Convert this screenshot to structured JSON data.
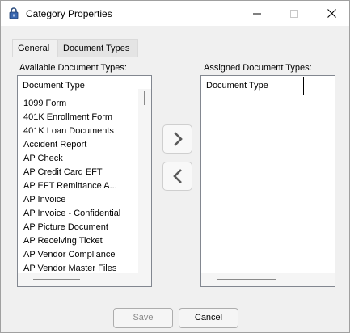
{
  "window": {
    "title": "Category Properties"
  },
  "tabs": [
    {
      "label": "General"
    },
    {
      "label": "Document Types"
    }
  ],
  "available": {
    "label": "Available Document Types:",
    "column_header": "Document Type",
    "items": [
      "1099 Form",
      "401K Enrollment Form",
      "401K Loan Documents",
      "Accident Report",
      "AP Check",
      "AP Credit Card EFT",
      "AP EFT Remittance A...",
      "AP Invoice",
      "AP Invoice - Confidential",
      "AP Picture Document",
      "AP Receiving Ticket",
      "AP Vendor Compliance",
      "AP Vendor Master Files"
    ]
  },
  "assigned": {
    "label": "Assigned Document Types:",
    "column_header": "Document Type",
    "items": []
  },
  "buttons": {
    "save": "Save",
    "cancel": "Cancel"
  },
  "icons": {
    "window_icon": "padlock-icon",
    "assign": "chevron-right-icon",
    "unassign": "chevron-left-icon"
  },
  "colors": {
    "window_bg": "#f0f0f0",
    "list_bg": "#ffffff",
    "arrow_color": "#5a5a5a",
    "disabled_text": "#8a8a8a"
  }
}
